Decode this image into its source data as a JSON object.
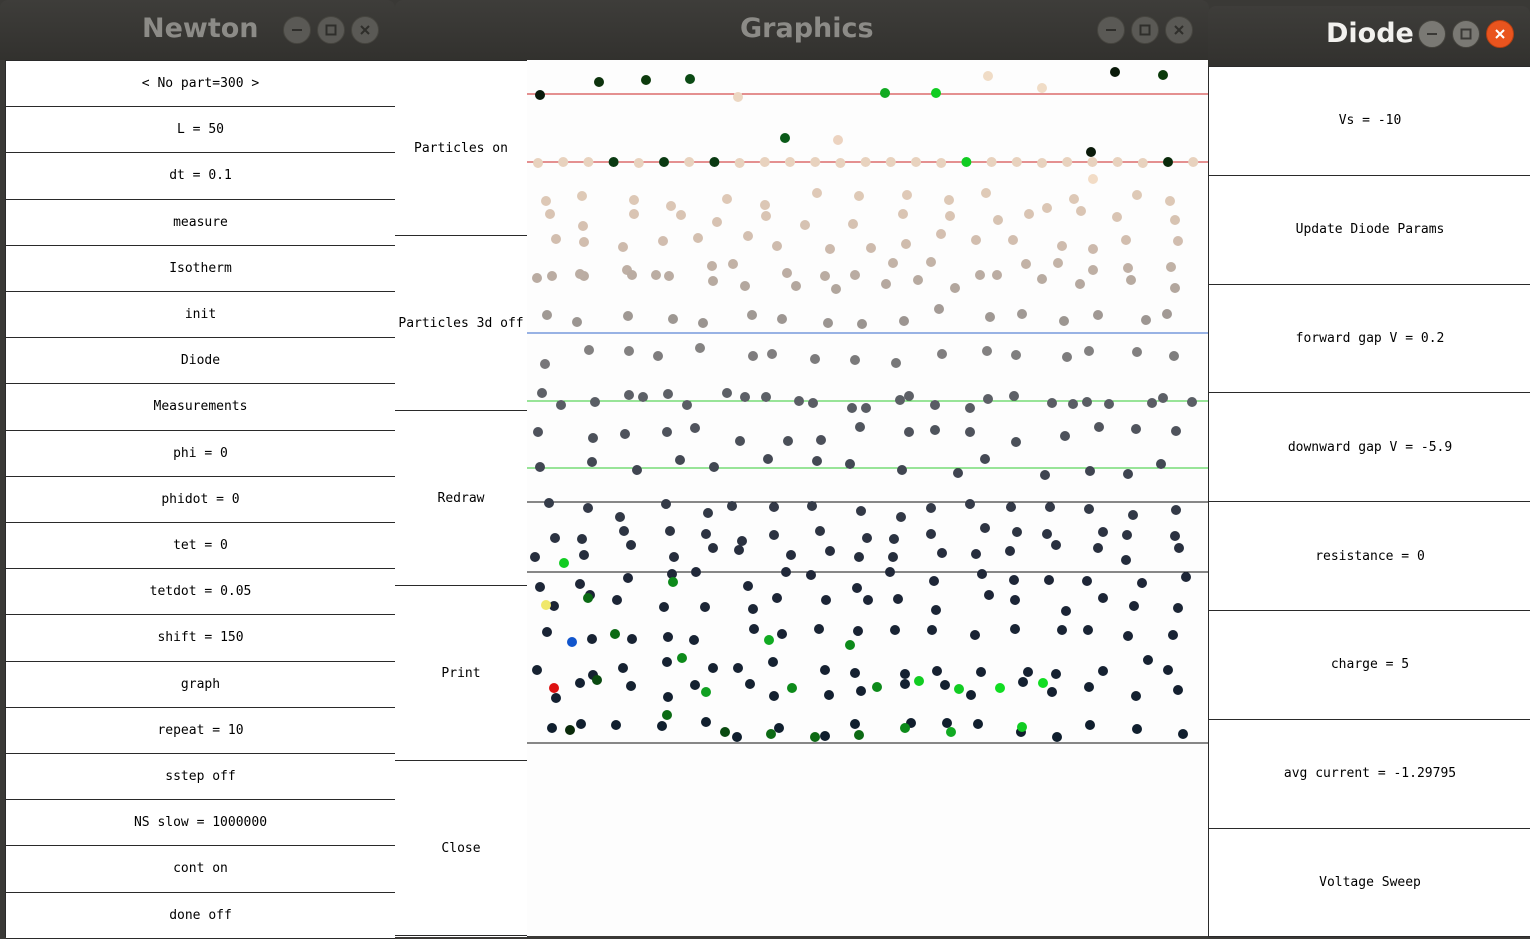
{
  "newton": {
    "title": "Newton",
    "items": [
      "< No part=300 >",
      "L = 50",
      "dt = 0.1",
      "measure",
      "Isotherm",
      "init",
      "Diode",
      "Measurements",
      "phi = 0",
      "phidot = 0",
      "tet = 0",
      "tetdot = 0.05",
      "shift = 150",
      "graph",
      "repeat = 10",
      "sstep off",
      "NS slow = 1000000",
      "cont on",
      "done off"
    ]
  },
  "graphics": {
    "title": "Graphics",
    "buttons": [
      "Particles on",
      "Particles 3d off",
      "Redraw",
      "Print",
      "Close"
    ]
  },
  "diode": {
    "title": "Diode",
    "items": [
      "Vs = -10",
      "Update Diode Params",
      "forward gap V = 0.2",
      "downward gap V = -5.9",
      "resistance = 0",
      "charge = 5",
      "avg current = -1.29795",
      "Voltage Sweep"
    ]
  },
  "window_icons": {
    "minimize": "minimize-icon",
    "maximize": "maximize-icon",
    "close": "close-icon"
  },
  "colors": {
    "titlebar": "#383734",
    "title_text": "#8c8b87",
    "close_active": "#e9541e",
    "line_red": "#cc2222",
    "line_blue": "#3366cc",
    "line_green": "#33cc33",
    "line_black": "#111111"
  }
}
